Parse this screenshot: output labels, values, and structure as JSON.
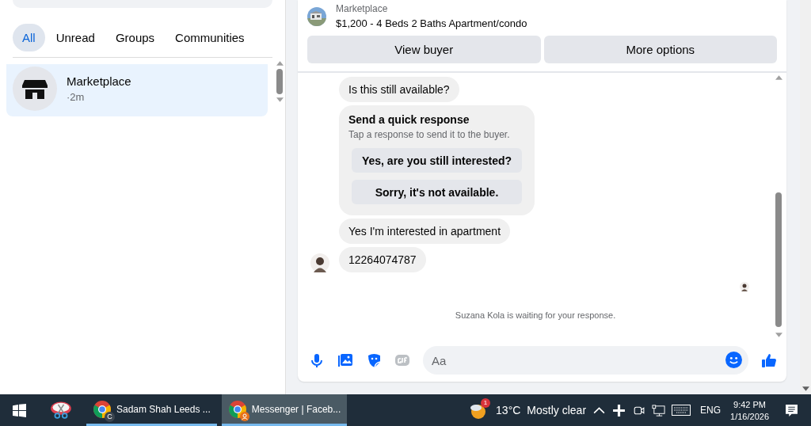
{
  "tabs": [
    {
      "label": "All",
      "selected": true
    },
    {
      "label": "Unread",
      "selected": false
    },
    {
      "label": "Groups",
      "selected": false
    },
    {
      "label": "Communities",
      "selected": false
    }
  ],
  "conversations": [
    {
      "name": "Marketplace",
      "time": "·2m",
      "selected": true
    }
  ],
  "listing": {
    "source": "Marketplace",
    "title": "$1,200 - 4 Beds 2 Baths Apartment/condo"
  },
  "actions": [
    "View buyer",
    "More options"
  ],
  "messages": [
    {
      "kind": "text",
      "text": "Is this still available?",
      "avatar": false
    },
    {
      "kind": "quick_response",
      "title": "Send a quick response",
      "subtitle": "Tap a response to send it to the buyer.",
      "options": [
        "Yes, are you still interested?",
        "Sorry, it's not available."
      ]
    },
    {
      "kind": "text",
      "text": "Yes I'm interested in apartment",
      "avatar": false
    },
    {
      "kind": "text",
      "text": "12264074787",
      "avatar": true
    }
  ],
  "status": "Suzana Kola is waiting for your response.",
  "composer": {
    "placeholder": "Aa"
  },
  "taskbar": {
    "apps": [
      {
        "label": "Sadam Shah Leeds ...",
        "profile": "C",
        "selected": false
      },
      {
        "label": "Messenger | Faceb...",
        "selected": true
      }
    ],
    "weather": {
      "badge": "1",
      "temp": "13°C",
      "text": "Mostly clear"
    },
    "language": "ENG",
    "time": "9:42 PM",
    "date": "1/16/2026"
  }
}
